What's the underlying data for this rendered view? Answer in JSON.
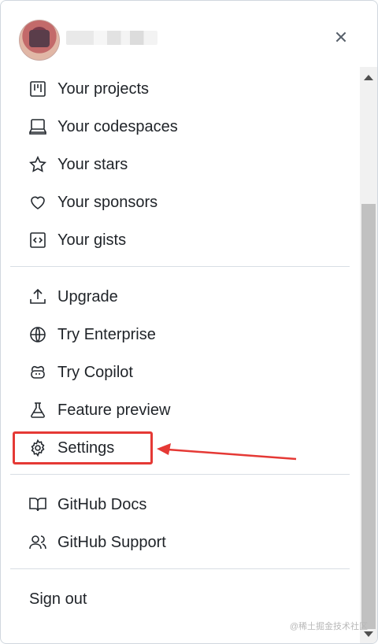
{
  "header": {
    "close_icon": "close-icon"
  },
  "menu": {
    "items": [
      {
        "label": "Your projects",
        "icon": "project-icon"
      },
      {
        "label": "Your codespaces",
        "icon": "codespaces-icon"
      },
      {
        "label": "Your stars",
        "icon": "star-icon"
      },
      {
        "label": "Your sponsors",
        "icon": "heart-icon"
      },
      {
        "label": "Your gists",
        "icon": "code-square-icon"
      },
      {
        "label": "Upgrade",
        "icon": "upload-icon"
      },
      {
        "label": "Try Enterprise",
        "icon": "globe-icon"
      },
      {
        "label": "Try Copilot",
        "icon": "copilot-icon"
      },
      {
        "label": "Feature preview",
        "icon": "beaker-icon"
      },
      {
        "label": "Settings",
        "icon": "gear-icon"
      },
      {
        "label": "GitHub Docs",
        "icon": "book-icon"
      },
      {
        "label": "GitHub Support",
        "icon": "people-icon"
      },
      {
        "label": "Sign out"
      }
    ]
  },
  "annotation": {
    "highlight_color": "#e53935"
  },
  "watermark": "@稀土掘金技术社区"
}
